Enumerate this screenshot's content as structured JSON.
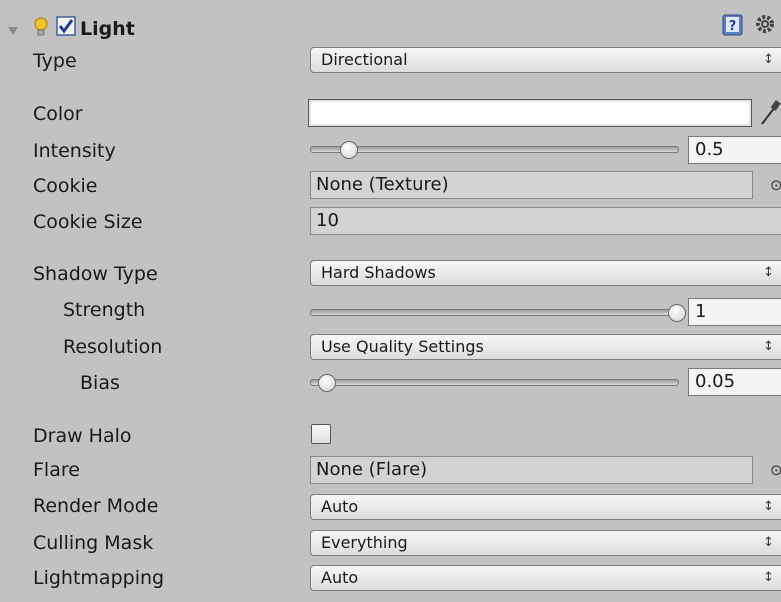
{
  "header": {
    "title": "Light"
  },
  "rows": {
    "type": {
      "label": "Type",
      "value": "Directional"
    },
    "color": {
      "label": "Color",
      "value": "#ffffff"
    },
    "intensity": {
      "label": "Intensity",
      "value": "0.5",
      "slider_fraction": 0.0625
    },
    "cookie": {
      "label": "Cookie",
      "value": "None (Texture)"
    },
    "cookie_size": {
      "label": "Cookie Size",
      "value": "10"
    },
    "shadow_type": {
      "label": "Shadow Type",
      "value": "Hard Shadows"
    },
    "strength": {
      "label": "Strength",
      "value": "1",
      "slider_fraction": 1.0
    },
    "resolution": {
      "label": "Resolution",
      "value": "Use Quality Settings"
    },
    "bias": {
      "label": "Bias",
      "value": "0.05",
      "slider_fraction": 0.0
    },
    "draw_halo": {
      "label": "Draw Halo",
      "checked": false
    },
    "flare": {
      "label": "Flare",
      "value": "None (Flare)"
    },
    "render_mode": {
      "label": "Render Mode",
      "value": "Auto"
    },
    "culling_mask": {
      "label": "Culling Mask",
      "value": "Everything"
    },
    "lightmapping": {
      "label": "Lightmapping",
      "value": "Auto"
    }
  },
  "icons": {
    "foldout": "triangle-down-icon",
    "light": "light-bulb-icon",
    "enabled": "checkbox-checked-icon",
    "help": "help-book-icon",
    "settings": "gear-icon",
    "eyedropper": "eyedropper-icon",
    "object_picker": "object-picker-icon",
    "popup_arrows": "up-down-arrows-icon"
  },
  "colors": {
    "panel_bg": "#c2c2c2",
    "accent": "#2b56a8"
  }
}
